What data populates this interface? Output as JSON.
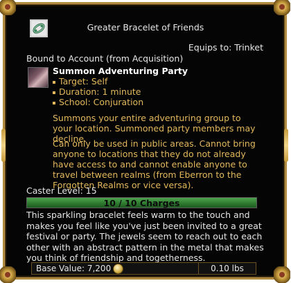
{
  "item": {
    "title": "Greater Bracelet of Friends",
    "icon": "bracelet-icon",
    "equips_to": "Equips to: Trinket",
    "binding": "Bound to Account (from Acquisition)"
  },
  "spell": {
    "icon": "summon-party-icon",
    "name": "Summon Adventuring Party",
    "properties": [
      "Target: Self",
      "Duration: 1 minute",
      "School: Conjuration"
    ],
    "description_1": "Summons your entire adventuring group to your location. Summoned party members may decline.",
    "description_2": "Can only be used in public areas. Cannot bring anyone to locations that they do not already have access to and cannot enable anyone to travel between realms (from Eberron to the Forgotten Realms or vice versa)."
  },
  "caster_level": "Caster Level: 15",
  "charges": {
    "label": "10 / 10 Charges",
    "current": 10,
    "max": 10
  },
  "flavor_text": "This sparkling bracelet feels warm to the touch and makes you feel like you've just been invited to a great festival or party. The jewels seem to reach out to each other with an abstract pattern in the metal that makes you think of friendship and togetherness.",
  "footer": {
    "base_value": "Base Value: 7,200",
    "currency_icon": "coin-icon",
    "weight": "0.10 lbs"
  },
  "colors": {
    "gold_text": "#e3b85c",
    "frame_gold": "#b08a3e",
    "charge_green": "#2f7a30"
  }
}
